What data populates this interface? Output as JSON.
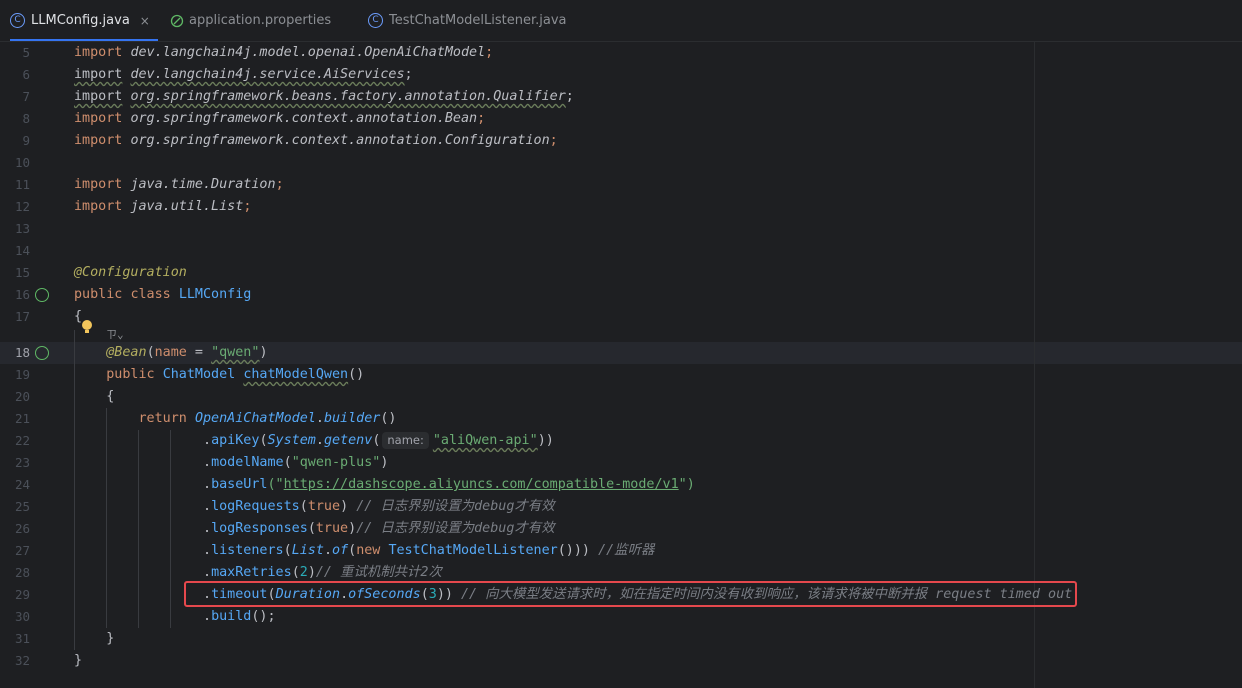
{
  "tabs": [
    {
      "label": "LLMConfig.java",
      "icon": "class-c-icon",
      "active": true
    },
    {
      "label": "application.properties",
      "icon": "properties-leaf-icon",
      "active": false
    },
    {
      "label": "TestChatModelListener.java",
      "icon": "class-c-icon",
      "active": false
    }
  ],
  "tab_close_glyph": "×",
  "line_numbers": [
    "5",
    "6",
    "7",
    "8",
    "9",
    "10",
    "11",
    "12",
    "13",
    "14",
    "15",
    "16",
    "17",
    "18",
    "19",
    "20",
    "21",
    "22",
    "23",
    "24",
    "25",
    "26",
    "27",
    "28",
    "29",
    "30",
    "31",
    "32"
  ],
  "code": {
    "l5": {
      "kw": "import",
      "pkg": "dev.langchain4j.model.openai.OpenAiChatModel",
      "end": ";"
    },
    "l6": {
      "kw": "import",
      "pkg": "dev.langchain4j.service.AiServices",
      "end": ";"
    },
    "l7": {
      "kw": "import",
      "pkg": "org.springframework.beans.factory.annotation.Qualifier",
      "end": ";"
    },
    "l8": {
      "kw": "import",
      "pkg": "org.springframework.context.annotation.Bean",
      "end": ";"
    },
    "l9": {
      "kw": "import",
      "pkg": "org.springframework.context.annotation.Configuration",
      "end": ";"
    },
    "l11": {
      "kw": "import",
      "pkg": "java.time.Duration",
      "end": ";"
    },
    "l12": {
      "kw": "import",
      "pkg": "java.util.List",
      "end": ";"
    },
    "l15": {
      "ann": "@Configuration"
    },
    "l16": {
      "kw1": "public",
      "kw2": "class",
      "name": "LLMConfig"
    },
    "l17": {
      "brace": "{"
    },
    "l17_hint": "ㄗ⌄",
    "l18": {
      "ann": "@Bean",
      "open": "(",
      "param": "name",
      "eq": " = ",
      "str": "\"qwen\"",
      "close": ")"
    },
    "l19": {
      "kw": "public",
      "type": "ChatModel",
      "method": "chatModelQwen",
      "paren": "()"
    },
    "l20": {
      "brace": "{"
    },
    "l21": {
      "kw": "return",
      "cls": "OpenAiChatModel",
      "dot": ".",
      "method": "builder",
      "paren": "()"
    },
    "l22": {
      "dot": ".",
      "method": "apiKey",
      "open": "(",
      "cls": "System",
      "dot2": ".",
      "method2": "getenv",
      "open2": "(",
      "hint": "name:",
      "str": "\"aliQwen-api\"",
      "close": "))"
    },
    "l23": {
      "dot": ".",
      "method": "modelName",
      "open": "(",
      "str": "\"qwen-plus\"",
      "close": ")"
    },
    "l24": {
      "dot": ".",
      "method": "baseUrl",
      "open": "(\"",
      "url": "https://dashscope.aliyuncs.com/compatible-mode/v1",
      "close": "\")"
    },
    "l25": {
      "dot": ".",
      "method": "logRequests",
      "open": "(",
      "kw": "true",
      "close": ") ",
      "cmt": "// 日志界别设置为debug才有效"
    },
    "l26": {
      "dot": ".",
      "method": "logResponses",
      "open": "(",
      "kw": "true",
      "close": ")",
      "cmt": "// 日志界别设置为debug才有效"
    },
    "l27": {
      "dot": ".",
      "method": "listeners",
      "open": "(",
      "cls": "List",
      "dot2": ".",
      "method2": "of",
      "open2": "(",
      "kw": "new",
      "cls2": "TestChatModelListener",
      "close": "())) ",
      "cmt": "//监听器"
    },
    "l28": {
      "dot": ".",
      "method": "maxRetries",
      "open": "(",
      "num": "2",
      "close": ")",
      "cmt": "// 重试机制共计2次"
    },
    "l29": {
      "dot": ".",
      "method": "timeout",
      "open": "(",
      "cls": "Duration",
      "dot2": ".",
      "method2": "ofSeconds",
      "open2": "(",
      "num": "3",
      "close": ")) ",
      "cmt": "// 向大模型发送请求时，如在指定时间内没有收到响应，该请求将被中断并报 request timed out"
    },
    "l30": {
      "dot": ".",
      "method": "build",
      "close": "();"
    },
    "l31": {
      "brace": "}"
    },
    "l32": {
      "brace": "}"
    }
  },
  "colors": {
    "background": "#1e1f22",
    "keyword": "#cf8e6d",
    "string": "#6aab73",
    "method": "#56a8f5",
    "annotation": "#b3ae60",
    "comment": "#7a7e85",
    "number": "#2aacb8",
    "highlight_box": "#e5484d",
    "tab_accent": "#3574f0"
  }
}
